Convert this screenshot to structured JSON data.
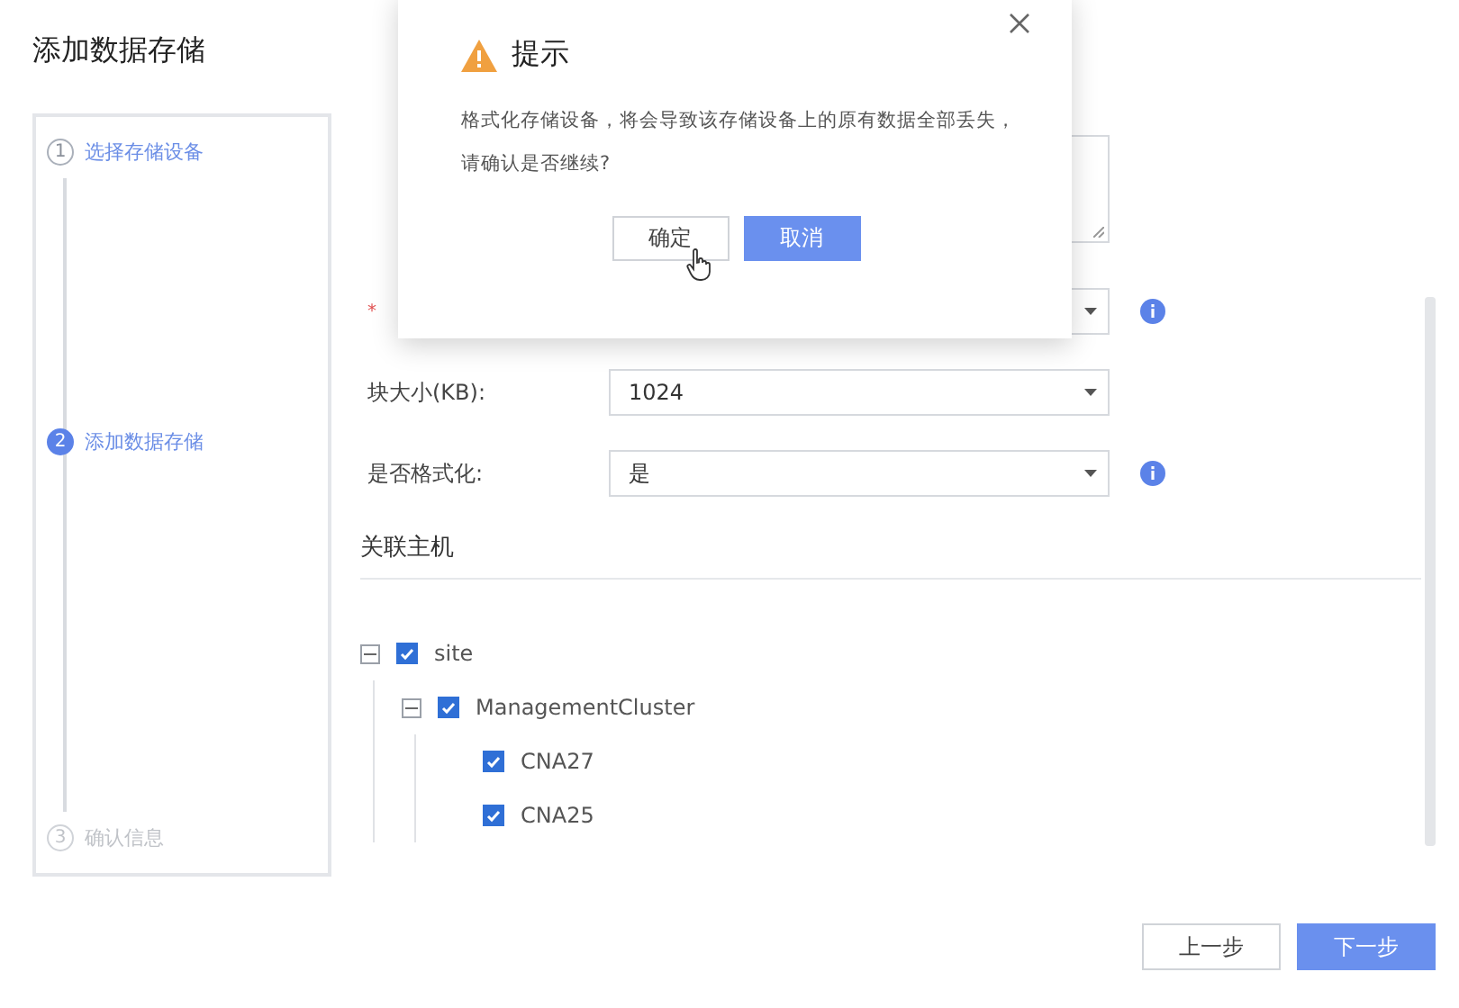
{
  "page_title": "添加数据存储",
  "steps": [
    {
      "number": "1",
      "label": "选择存储设备",
      "completed": true,
      "selected": false
    },
    {
      "number": "2",
      "label": "添加数据存储",
      "completed": false,
      "selected": true
    },
    {
      "number": "3",
      "label": "确认信息",
      "completed": false,
      "selected": false
    }
  ],
  "fields": [
    {
      "kind": "textarea",
      "info": false
    },
    {
      "kind": "select",
      "required_mark": "*",
      "info": true
    },
    {
      "kind": "select",
      "label": "块大小(KB):",
      "value": "1024",
      "info": false
    },
    {
      "kind": "select",
      "label": "是否格式化:",
      "value": "是",
      "info": true
    }
  ],
  "hosts_section": {
    "title": "关联主机",
    "tree": [
      {
        "label": "site",
        "checked": true,
        "expanded": true,
        "children": [
          {
            "label": "ManagementCluster",
            "checked": true,
            "expanded": true,
            "children": [
              {
                "label": "CNA27",
                "checked": true
              },
              {
                "label": "CNA25",
                "checked": true
              }
            ]
          }
        ]
      }
    ]
  },
  "buttons": [
    {
      "label": "上一步",
      "primary": false
    },
    {
      "label": "下一步",
      "primary": true
    }
  ],
  "dialog": {
    "title": "提示",
    "message": "格式化存储设备，将会导致该存储设备上的原有数据全部丢失，请确认是否继续?",
    "buttons": [
      {
        "label": "确定",
        "primary": false
      },
      {
        "label": "取消",
        "primary": true
      }
    ]
  }
}
